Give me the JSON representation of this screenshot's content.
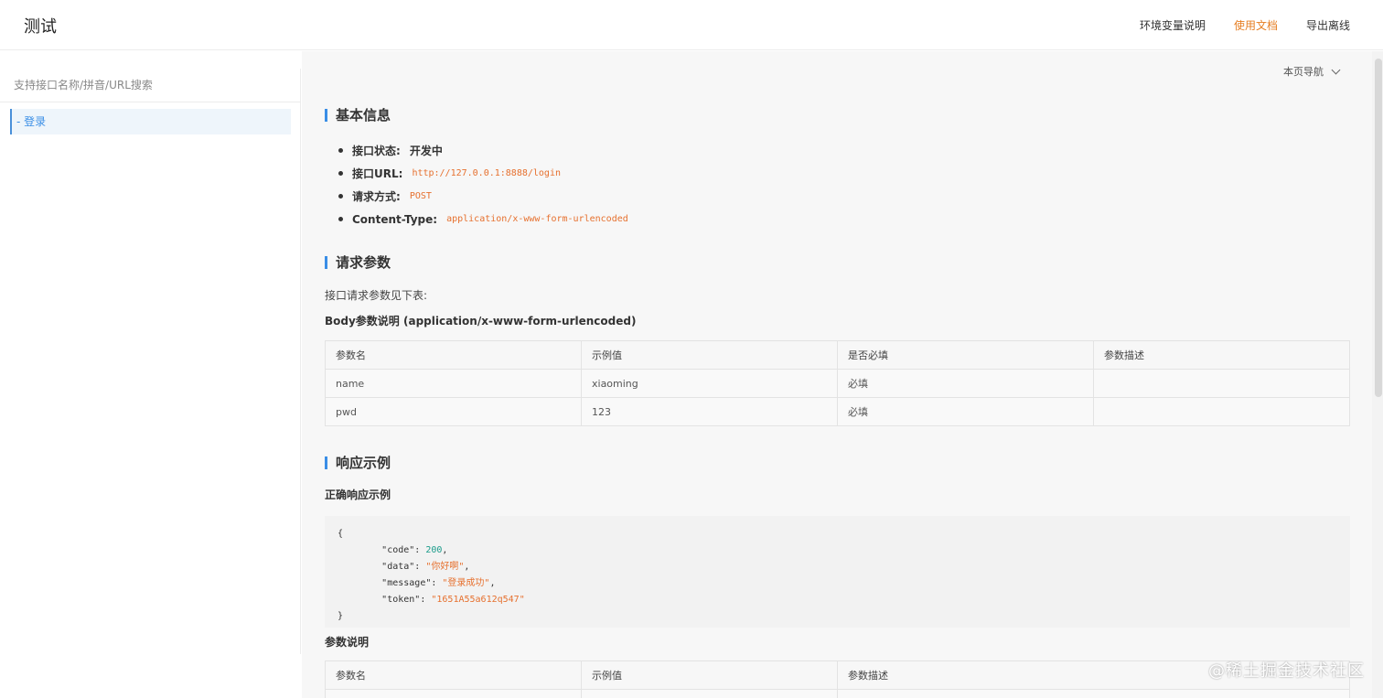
{
  "header": {
    "title": "测试",
    "nav": [
      {
        "label": "环境变量说明",
        "active": false
      },
      {
        "label": "使用文档",
        "active": true
      },
      {
        "label": "导出离线",
        "active": false
      }
    ]
  },
  "sidebar": {
    "search_placeholder": "支持接口名称/拼音/URL搜索",
    "items": [
      {
        "label": "- 登录"
      }
    ]
  },
  "page_nav": {
    "label": "本页导航"
  },
  "basic_info": {
    "title": "基本信息",
    "status_label": "接口状态:",
    "status_value": "开发中",
    "url_label": "接口URL:",
    "url_value": "http://127.0.0.1:8888/login",
    "method_label": "请求方式:",
    "method_value": "POST",
    "content_type_label": "Content-Type:",
    "content_type_value": "application/x-www-form-urlencoded"
  },
  "request": {
    "title": "请求参数",
    "desc": "接口请求参数见下表:",
    "body_title": "Body参数说明 (application/x-www-form-urlencoded)",
    "columns": [
      "参数名",
      "示例值",
      "是否必填",
      "参数描述"
    ],
    "rows": [
      [
        "name",
        "xiaoming",
        "必填",
        ""
      ],
      [
        "pwd",
        "123",
        "必填",
        ""
      ]
    ]
  },
  "response": {
    "title": "响应示例",
    "success_title": "正确响应示例",
    "code": {
      "open": "{",
      "close": "}",
      "lines": [
        {
          "key": "\"code\"",
          "value": "200",
          "type": "num",
          "comma": ","
        },
        {
          "key": "\"data\"",
          "value": "\"你好啊\"",
          "type": "str",
          "comma": ","
        },
        {
          "key": "\"message\"",
          "value": "\"登录成功\"",
          "type": "str",
          "comma": ","
        },
        {
          "key": "\"token\"",
          "value": "\"1651A55a612q547\"",
          "type": "str",
          "comma": ""
        }
      ]
    },
    "param_title": "参数说明",
    "columns": [
      "参数名",
      "示例值",
      "参数描述"
    ]
  },
  "watermark": "@稀土掘金技术社区",
  "colors": {
    "accent": "#3a8ee6",
    "active_nav": "#e67e22",
    "code_string": "#e6702e",
    "code_number": "#1a9b8a"
  }
}
